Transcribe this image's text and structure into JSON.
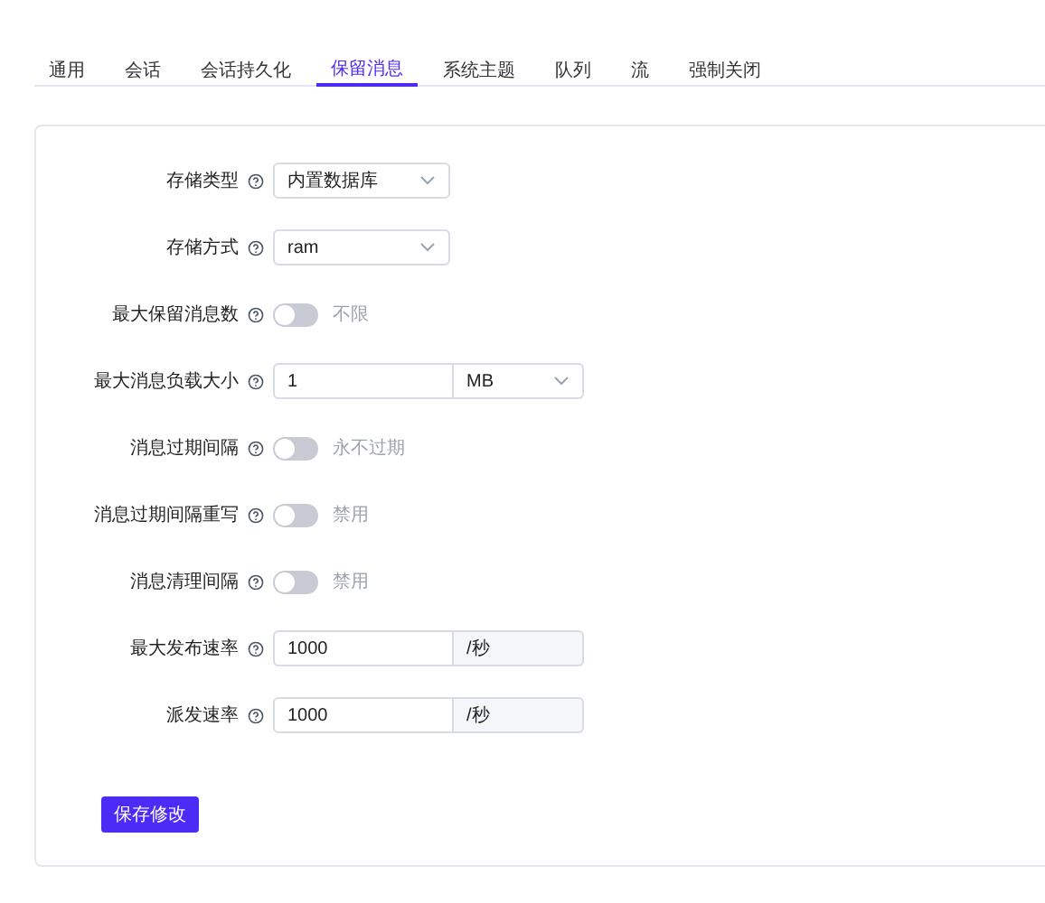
{
  "tabs": [
    {
      "label": "通用",
      "selected": false
    },
    {
      "label": "会话",
      "selected": false
    },
    {
      "label": "会话持久化",
      "selected": false
    },
    {
      "label": "保留消息",
      "selected": true
    },
    {
      "label": "系统主题",
      "selected": false
    },
    {
      "label": "队列",
      "selected": false
    },
    {
      "label": "流",
      "selected": false
    },
    {
      "label": "强制关闭",
      "selected": false
    }
  ],
  "fields": [
    {
      "label": "存储类型",
      "kind": "select",
      "value": "内置数据库"
    },
    {
      "label": "存储方式",
      "kind": "select",
      "value": "ram"
    },
    {
      "label": "最大保留消息数",
      "kind": "toggle",
      "on": false,
      "text": "不限"
    },
    {
      "label": "最大消息负载大小",
      "kind": "input_unit_select",
      "value": "1",
      "unit": "MB"
    },
    {
      "label": "消息过期间隔",
      "kind": "toggle",
      "on": false,
      "text": "永不过期"
    },
    {
      "label": "消息过期间隔重写",
      "kind": "toggle",
      "on": false,
      "text": "禁用"
    },
    {
      "label": "消息清理间隔",
      "kind": "toggle",
      "on": false,
      "text": "禁用"
    },
    {
      "label": "最大发布速率",
      "kind": "input_addon",
      "value": "1000",
      "unit": "/秒"
    },
    {
      "label": "派发速率",
      "kind": "input_addon",
      "value": "1000",
      "unit": "/秒"
    }
  ],
  "save_button": "保存修改"
}
